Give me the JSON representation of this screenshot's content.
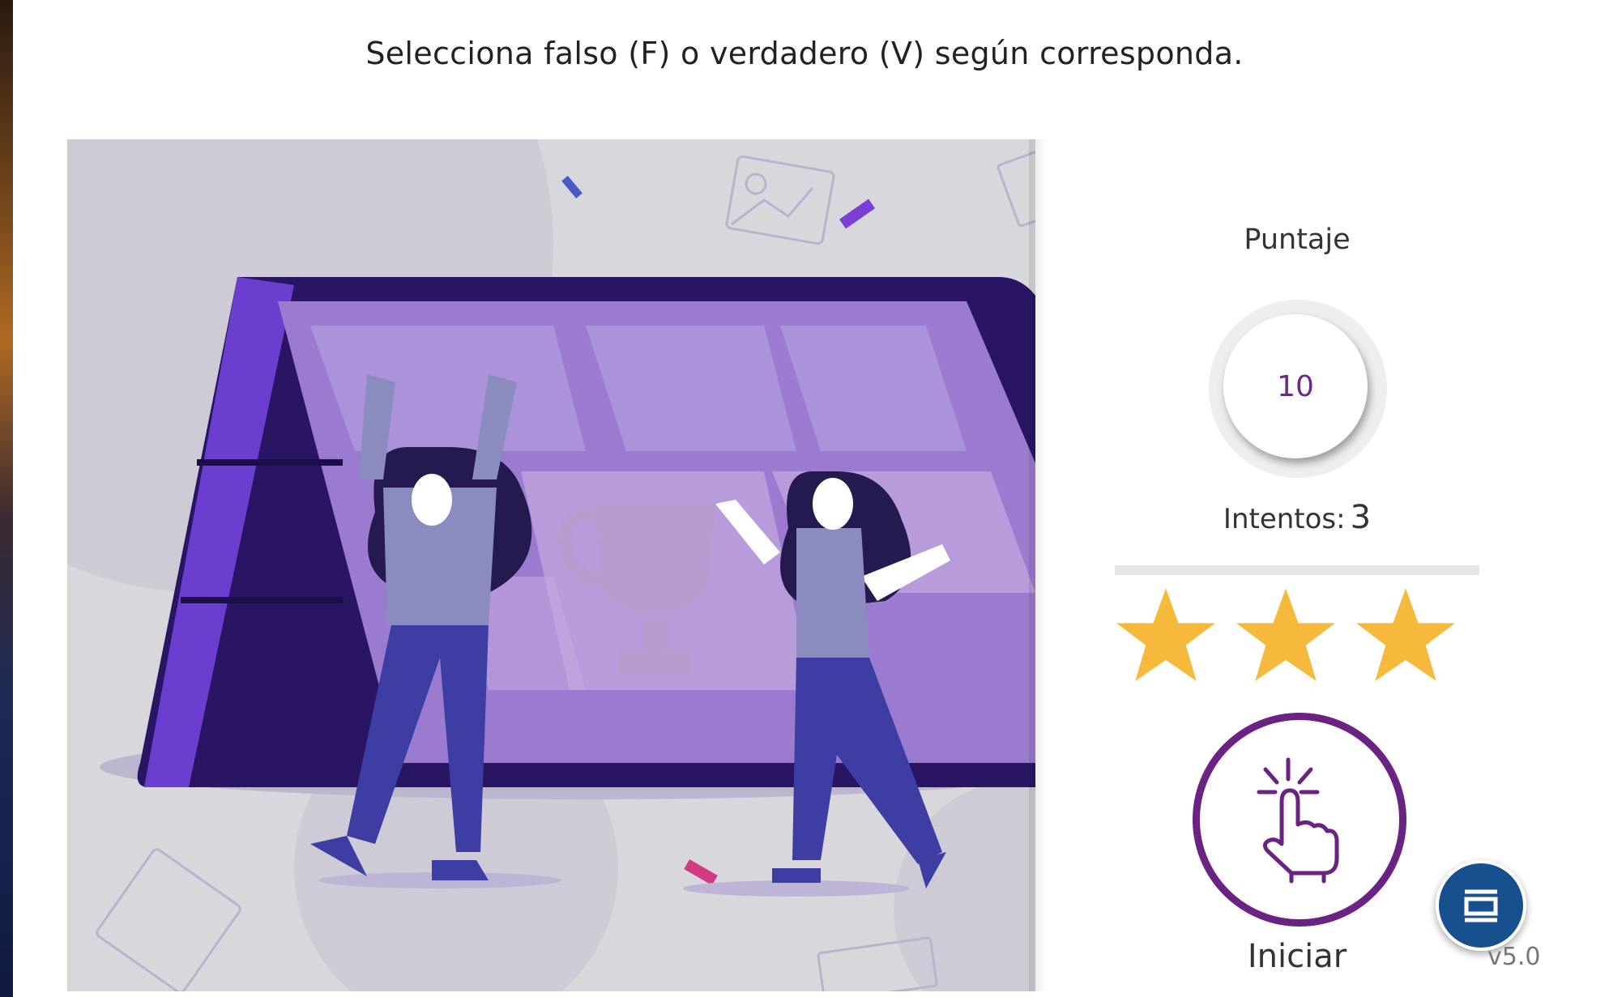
{
  "instruction": "Selecciona falso (F) o verdadero (V) según corresponda.",
  "score": {
    "title": "Puntaje",
    "value": "10",
    "attempts_label": "Intentos:",
    "attempts_value": "3",
    "stars_earned": 3,
    "stars_total": 3
  },
  "start_button": {
    "label": "Iniciar",
    "icon": "hand-pointer-click-icon"
  },
  "menu_button": {
    "icon": "window-panel-icon"
  },
  "version": "v5.0",
  "colors": {
    "accent_purple": "#6a2283",
    "star_gold": "#f6b93b",
    "fab_blue": "#17508e",
    "tablet_purple": "#2e1366"
  },
  "illustration": {
    "subject": "celebration-illustration"
  }
}
